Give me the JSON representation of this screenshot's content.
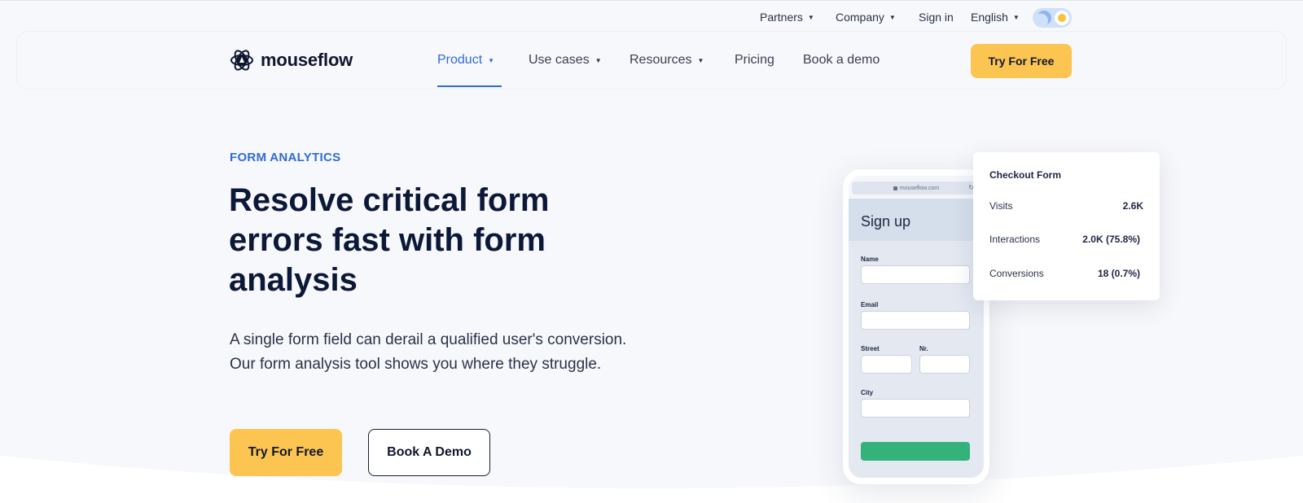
{
  "topbar": {
    "items": [
      {
        "label": "Partners",
        "has_dropdown": true
      },
      {
        "label": "Company",
        "has_dropdown": true
      },
      {
        "label": "Sign in",
        "has_dropdown": false
      },
      {
        "label": "English",
        "has_dropdown": true
      }
    ],
    "caret": "▼",
    "theme_toggle": {
      "left_icon": "moon-icon",
      "right_icon": "sun-icon",
      "mode": "light"
    }
  },
  "nav": {
    "logo_text": "mouseflow",
    "items": [
      {
        "label": "Product",
        "has_dropdown": true,
        "active": true
      },
      {
        "label": "Use cases",
        "has_dropdown": true,
        "active": false
      },
      {
        "label": "Resources",
        "has_dropdown": true,
        "active": false
      },
      {
        "label": "Pricing",
        "has_dropdown": false,
        "active": false
      },
      {
        "label": "Book a demo",
        "has_dropdown": false,
        "active": false
      }
    ],
    "cta_label": "Try For Free"
  },
  "hero": {
    "eyebrow": "FORM ANALYTICS",
    "headline": "Resolve critical form errors fast with form analysis",
    "subtext": "A single form field can derail a qualified user's conversion. Our form analysis tool shows you where they struggle.",
    "primary_cta": "Try For Free",
    "secondary_cta": "Book A Demo"
  },
  "phone": {
    "url": "mouseflow.com",
    "title": "Sign up",
    "fields": {
      "name": "Name",
      "email": "Email",
      "street": "Street",
      "nr": "Nr.",
      "city": "City"
    }
  },
  "stats_card": {
    "title": "Checkout Form",
    "rows": [
      {
        "label": "Visits",
        "value": "2.6K"
      },
      {
        "label": "Interactions",
        "value": "2.0K (75.8%)"
      },
      {
        "label": "Conversions",
        "value": "18 (0.7%)"
      }
    ]
  },
  "colors": {
    "accent_blue": "#2f6bd6",
    "cta_yellow": "#fcc450",
    "submit_green": "#34b27b",
    "headline_navy": "#0c1838"
  }
}
